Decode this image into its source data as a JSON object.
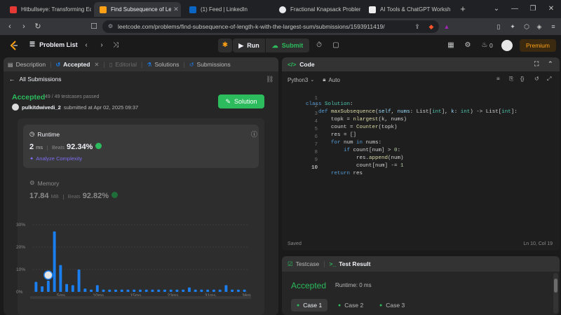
{
  "browser": {
    "tabs": [
      {
        "title": "Hitbullseye: Transforming Edu",
        "color": "#e53935",
        "active": false
      },
      {
        "title": "Find Subsequence of Lengt",
        "color": "#ffa116",
        "active": true
      },
      {
        "title": "(1) Feed | LinkedIn",
        "color": "#0a66c2",
        "active": false
      },
      {
        "title": "Fractional Knapsack Problem",
        "color": "#e8eaed",
        "active": false
      },
      {
        "title": "AI Tools & ChatGPT Worksho",
        "color": "#eeeeee",
        "active": false
      }
    ],
    "url": "leetcode.com/problems/find-subsequence-of-length-k-with-the-largest-sum/submissions/1593911419/"
  },
  "header": {
    "problem_list": "Problem List",
    "run": "Run",
    "submit": "Submit",
    "premium": "Premium",
    "fire_count": "0"
  },
  "left_tabs": [
    {
      "label": "Description",
      "state": "normal"
    },
    {
      "label": "Accepted",
      "state": "active"
    },
    {
      "label": "Editorial",
      "state": "disabled"
    },
    {
      "label": "Solutions",
      "state": "normal"
    },
    {
      "label": "Submissions",
      "state": "normal"
    }
  ],
  "submission": {
    "all_submissions": "All Submissions",
    "status": "Accepted",
    "testcases": "49 / 49 testcases passed",
    "user": "pulkitdwivedi_2",
    "submitted_at": "submitted at Apr 02, 2025 09:37",
    "solution_btn": "Solution",
    "runtime_title": "Runtime",
    "runtime_value": "2",
    "runtime_unit": "ms",
    "beats_label": "Beats",
    "runtime_beats": "92.34%",
    "analyze": "Analyze Complexity",
    "memory_title": "Memory",
    "memory_value": "17.84",
    "memory_unit": "MB",
    "memory_beats": "92.82%"
  },
  "chart_data": {
    "type": "bar",
    "yticks": [
      "30%",
      "20%",
      "10%",
      "0%"
    ],
    "xticks": [
      "5ms",
      "10ms",
      "15ms",
      "23ms",
      "31ms",
      "36ms"
    ],
    "values": [
      4.5,
      2.5,
      5,
      27,
      12,
      3.5,
      3,
      10,
      1.5,
      1,
      3,
      1,
      1,
      1,
      1,
      1,
      1,
      1,
      1,
      1,
      1,
      1,
      1,
      1,
      1,
      2,
      1,
      1,
      1,
      1,
      1,
      3,
      1,
      1,
      1
    ],
    "highlight_index": 2,
    "ylim": [
      0,
      30
    ],
    "bar_color": "#1a7eef"
  },
  "code": {
    "title": "Code",
    "language": "Python3",
    "mode": "Auto",
    "lines": [
      "class Solution:",
      "    def maxSubsequence(self, nums: List[int], k: int) -> List[int]:",
      "        topk = nlargest(k, nums)",
      "        count = Counter(topk)",
      "        res = []",
      "        for num in nums:",
      "            if count[num] > 0:",
      "                res.append(num)",
      "                count[num] -= 1",
      "        return res"
    ],
    "saved": "Saved",
    "cursor": "Ln 10, Col 19"
  },
  "test": {
    "testcase_tab": "Testcase",
    "result_tab": "Test Result",
    "status": "Accepted",
    "runtime": "Runtime: 0 ms",
    "cases": [
      "Case 1",
      "Case 2",
      "Case 3"
    ]
  }
}
